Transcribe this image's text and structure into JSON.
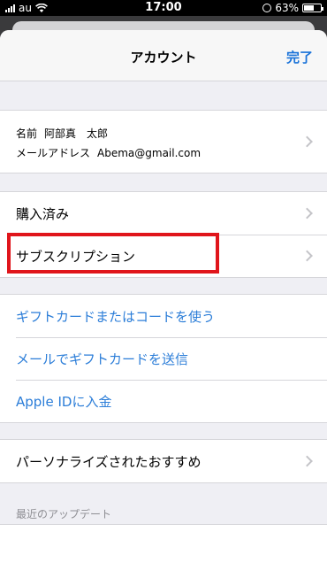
{
  "status_bar": {
    "carrier": "au",
    "time": "17:00",
    "battery_percent_text": "63%",
    "battery_level": 0.63
  },
  "nav": {
    "title": "アカウント",
    "done_label": "完了"
  },
  "profile": {
    "name_label": "名前",
    "name_value": "阿部真　太郎",
    "email_label": "メールアドレス",
    "email_value": "Abema@gmail.com"
  },
  "purchases": {
    "purchased_label": "購入済み",
    "subscriptions_label": "サブスクリプション"
  },
  "gift": {
    "redeem_label": "ギフトカードまたはコードを使う",
    "send_label": "メールでギフトカードを送信",
    "add_funds_label": "Apple IDに入金"
  },
  "recommendations": {
    "label": "パーソナライズされたおすすめ"
  },
  "updates": {
    "section_header": "最近のアップデート"
  },
  "colors": {
    "accent": "#2b7dd8",
    "highlight": "#e0151b",
    "background": "#efeff4"
  }
}
